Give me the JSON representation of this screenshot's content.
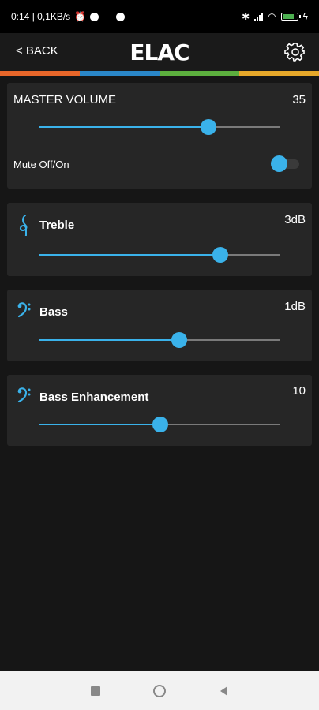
{
  "status_bar": {
    "time_speed": "0:14 | 0,1KB/s",
    "battery_color": "#4caf50"
  },
  "header": {
    "back_label": "< BACK",
    "logo": "ELAC",
    "strip_colors": [
      "#e8672a",
      "#2a87c8",
      "#5caf3e",
      "#e6a82a"
    ]
  },
  "master_volume": {
    "title": "MASTER VOLUME",
    "value": "35",
    "level": 0.7,
    "mute_label": "Mute Off/On",
    "mute_state": "on"
  },
  "treble": {
    "title": "Treble",
    "value": "3dB",
    "level": 0.75,
    "icon": "treble-clef-icon"
  },
  "bass": {
    "title": "Bass",
    "value": "1dB",
    "level": 0.58,
    "icon": "bass-clef-icon"
  },
  "bass_enhancement": {
    "title": "Bass Enhancement",
    "value": "10",
    "level": 0.5,
    "icon": "bass-clef-icon"
  },
  "accent_color": "#3ab2ea",
  "nav_bar": {
    "buttons": [
      "recents-button",
      "home-button",
      "back-nav-button"
    ]
  }
}
